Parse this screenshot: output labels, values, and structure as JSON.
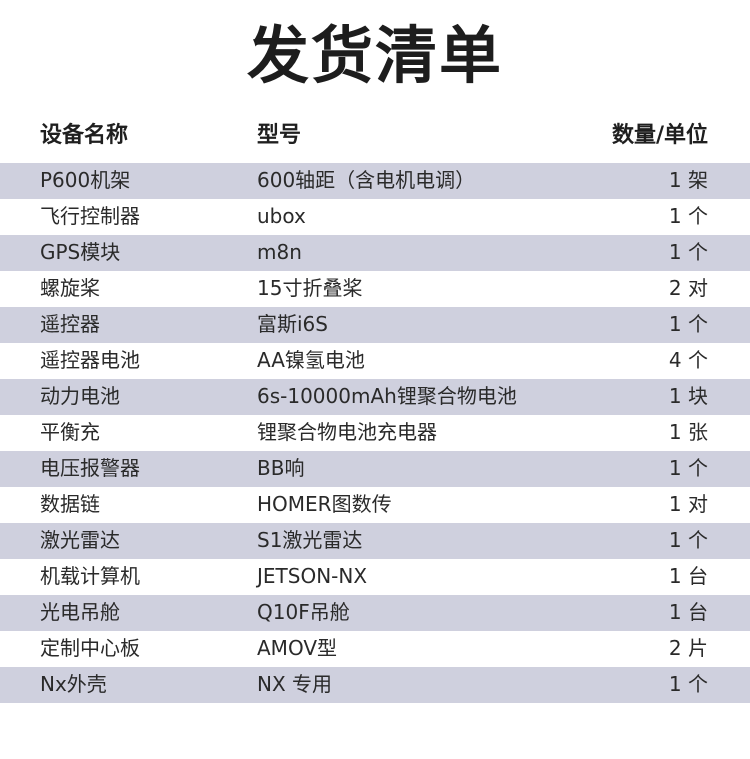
{
  "title": "发货清单",
  "headers": {
    "name": "设备名称",
    "model": "型号",
    "qty": "数量/单位"
  },
  "rows": [
    {
      "name": "P600机架",
      "model": "600轴距（含电机电调）",
      "qty": "1 架"
    },
    {
      "name": "飞行控制器",
      "model": "ubox",
      "qty": "1 个"
    },
    {
      "name": "GPS模块",
      "model": "m8n",
      "qty": "1 个"
    },
    {
      "name": "螺旋桨",
      "model": "15寸折叠桨",
      "qty": "2 对"
    },
    {
      "name": "遥控器",
      "model": "富斯i6S",
      "qty": "1 个"
    },
    {
      "name": "遥控器电池",
      "model": "AA镍氢电池",
      "qty": "4 个"
    },
    {
      "name": "动力电池",
      "model": "6s-10000mAh锂聚合物电池",
      "qty": "1 块"
    },
    {
      "name": "平衡充",
      "model": "锂聚合物电池充电器",
      "qty": "1 张"
    },
    {
      "name": "电压报警器",
      "model": "BB响",
      "qty": "1 个"
    },
    {
      "name": "数据链",
      "model": "HOMER图数传",
      "qty": "1 对"
    },
    {
      "name": "激光雷达",
      "model": "S1激光雷达",
      "qty": "1 个"
    },
    {
      "name": "机载计算机",
      "model": "JETSON-NX",
      "qty": "1 台"
    },
    {
      "name": "光电吊舱",
      "model": "Q10F吊舱",
      "qty": "1 台"
    },
    {
      "name": "定制中心板",
      "model": "AMOV型",
      "qty": "2 片"
    },
    {
      "name": "Nx外壳",
      "model": "NX 专用",
      "qty": "1 个"
    }
  ],
  "colors": {
    "row_shade": "#cfd0de",
    "text": "#2a2a2a"
  }
}
